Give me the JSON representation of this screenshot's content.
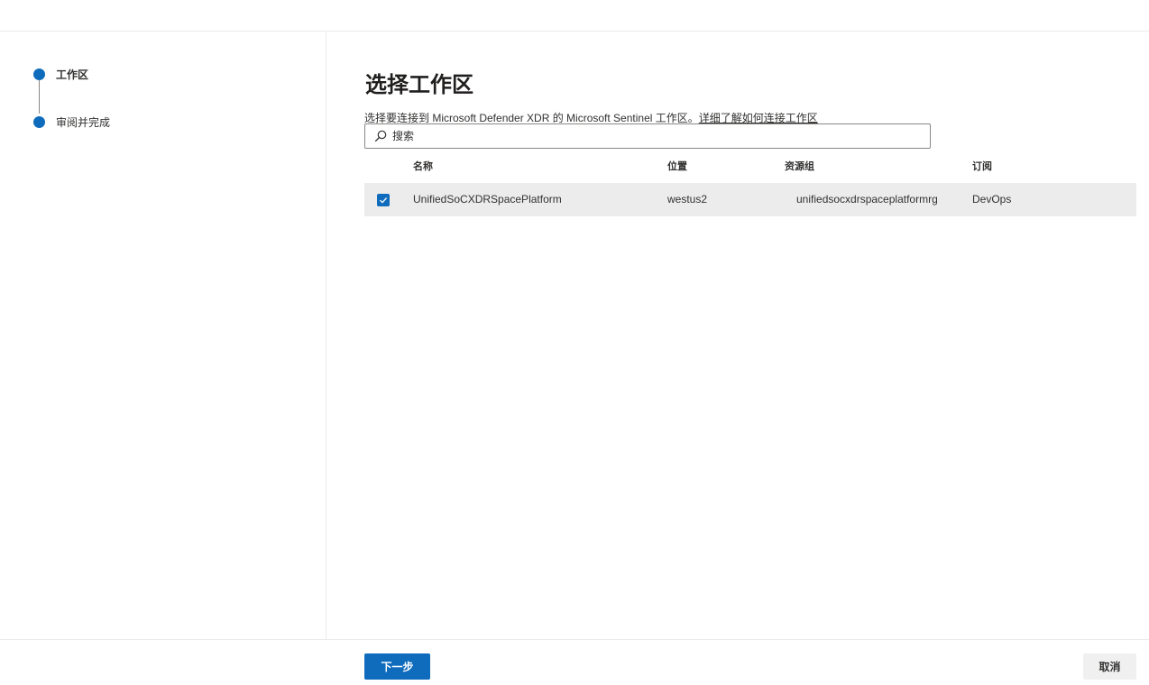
{
  "wizard": {
    "steps": [
      {
        "label": "工作区",
        "active": true
      },
      {
        "label": "审阅并完成",
        "active": false
      }
    ]
  },
  "main": {
    "title": "选择工作区",
    "description_prefix": "选择要连接到 Microsoft Defender XDR 的 Microsoft Sentinel 工作区。",
    "description_link": "详细了解如何连接工作区",
    "search": {
      "placeholder": "搜索",
      "value": ""
    },
    "table": {
      "columns": [
        "名称",
        "位置",
        "资源组",
        "订阅"
      ],
      "rows": [
        {
          "selected": true,
          "name": "UnifiedSoCXDRSpacePlatform",
          "location": "westus2",
          "resource_group": "unifiedsocxdrspaceplatformrg",
          "subscription": "DevOps"
        }
      ]
    }
  },
  "footer": {
    "next_label": "下一步",
    "cancel_label": "取消"
  },
  "colors": {
    "accent": "#0f6cbd",
    "row_selected_bg": "#ececec"
  },
  "icons": {
    "search": "search-icon",
    "checkbox": "checkmark-icon"
  }
}
